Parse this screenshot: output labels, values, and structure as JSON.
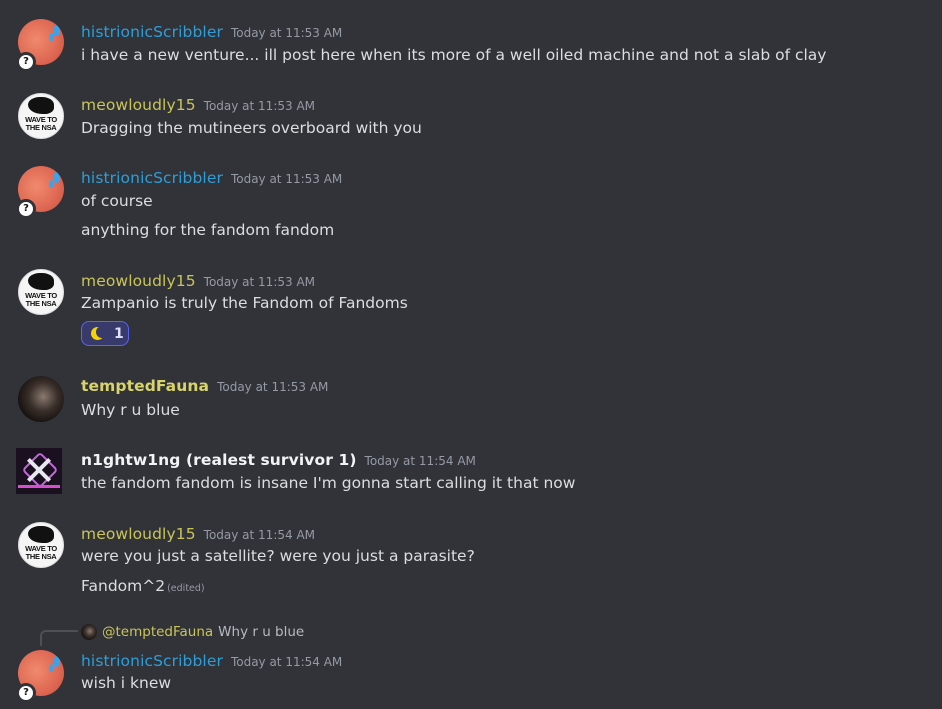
{
  "messages": [
    {
      "user": "histrionicScribbler",
      "time": "Today at 11:53 AM",
      "lines": [
        "i have a new venture... ill post here when its more of a well oiled machine and not a slab of clay"
      ]
    },
    {
      "user": "meowloudly15",
      "time": "Today at 11:53 AM",
      "lines": [
        "Dragging the mutineers overboard with you"
      ],
      "avatar_text": [
        "WAVE TO",
        "THE NSA"
      ]
    },
    {
      "user": "histrionicScribbler",
      "time": "Today at 11:53 AM",
      "lines": [
        "of course",
        "anything for the fandom fandom"
      ]
    },
    {
      "user": "meowloudly15",
      "time": "Today at 11:53 AM",
      "lines": [
        "Zampanio is truly the Fandom of Fandoms"
      ],
      "reaction": {
        "emoji": "crescent-moon-icon",
        "count": "1"
      },
      "avatar_text": [
        "WAVE TO",
        "THE NSA"
      ]
    },
    {
      "user": "temptedFauna",
      "time": "Today at 11:53 AM",
      "lines": [
        "Why r u blue"
      ]
    },
    {
      "user": "n1ghtw1ng (realest survivor 1)",
      "time": "Today at 11:54 AM",
      "lines": [
        "the fandom fandom is insane I'm gonna start calling it that now"
      ]
    },
    {
      "user": "meowloudly15",
      "time": "Today at 11:54 AM",
      "lines": [
        "were you just a satellite? were you just a parasite?",
        "Fandom^2"
      ],
      "edited": "(edited)",
      "avatar_text": [
        "WAVE TO",
        "THE NSA"
      ]
    },
    {
      "user": "histrionicScribbler",
      "time": "Today at 11:54 AM",
      "lines": [
        "wish i knew"
      ],
      "reply": {
        "user": "@temptedFauna",
        "text": "Why r u blue"
      }
    }
  ],
  "status_icon": "?",
  "colors": {
    "background": "#313338",
    "histrionic": "#2e9ed8",
    "meowloudly": "#c9c557",
    "fauna": "#d9d46a",
    "reaction_border": "#5865f2"
  }
}
